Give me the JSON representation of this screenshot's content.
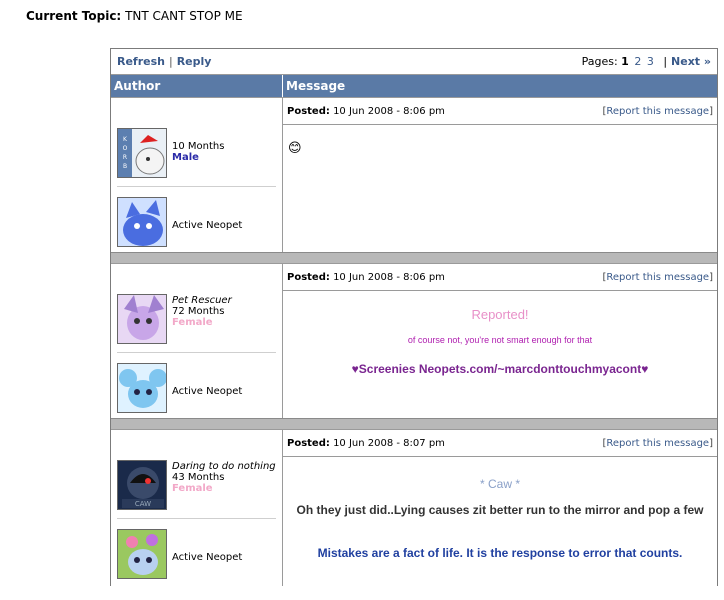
{
  "topic": {
    "label": "Current Topic:",
    "title": "TNT CANT STOP ME"
  },
  "nav": {
    "refresh": "Refresh",
    "sep": "|",
    "reply": "Reply",
    "pages_label": "Pages:",
    "page1": "1",
    "page2": "2",
    "page3": "3",
    "pipe": "|",
    "next": "Next »"
  },
  "header": {
    "author": "Author",
    "message": "Message"
  },
  "posts": [
    {
      "posted_label": "Posted:",
      "date": "10 Jun 2008 - 8:06 pm",
      "report": "Report this message",
      "title": "",
      "age": "10 Months",
      "gender": "Male",
      "active": "Active Neopet",
      "emoticon": "😊"
    },
    {
      "posted_label": "Posted:",
      "date": "10 Jun 2008 - 8:06 pm",
      "report": "Report this message",
      "title": "Pet Rescuer",
      "age": "72 Months",
      "gender": "Female",
      "active": "Active Neopet",
      "line1": "Reported!",
      "line2": "of course not, you're not smart enough for that",
      "line3": "♥Screenies Neopets.com/~marcdonttouchmyacont♥"
    },
    {
      "posted_label": "Posted:",
      "date": "10 Jun 2008 - 8:07 pm",
      "report": "Report this message",
      "title": "Daring to do nothing",
      "age": "43 Months",
      "gender": "Female",
      "active": "Active Neopet",
      "line1": "* Caw *",
      "line2": "Oh they just did..Lying causes zit better run to the mirror and pop a few",
      "line3": "Mistakes are a fact of life. It is the response to error that counts."
    }
  ],
  "colors": {
    "header": "#5a7aa6",
    "link": "#3a5a8a",
    "pink": "#e890c8",
    "purple": "#b020b0",
    "navy": "#2040a0"
  }
}
